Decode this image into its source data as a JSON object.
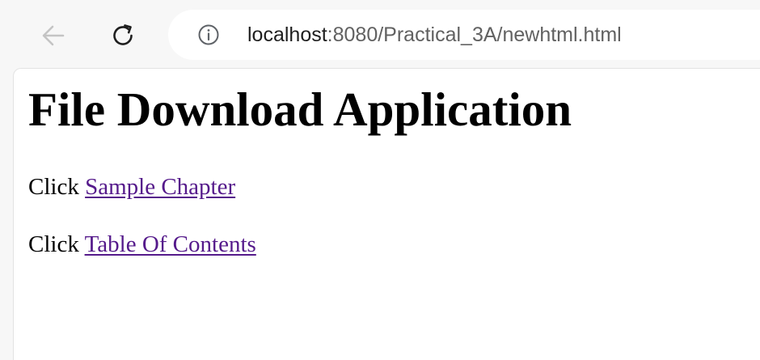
{
  "browser": {
    "url_host": "localhost",
    "url_rest": ":8080/Practical_3A/newhtml.html",
    "icons": {
      "back": "arrow-left-icon",
      "reload": "reload-icon",
      "site_info": "info-icon"
    }
  },
  "page": {
    "title": "File Download Application",
    "lines": [
      {
        "prefix": "Click",
        "link_text": "Sample Chapter"
      },
      {
        "prefix": "Click",
        "link_text": "Table Of Contents"
      }
    ]
  },
  "colors": {
    "visited_link": "#551a8b",
    "toolbar_bg": "#f7f7f7",
    "page_bg": "#ffffff"
  }
}
